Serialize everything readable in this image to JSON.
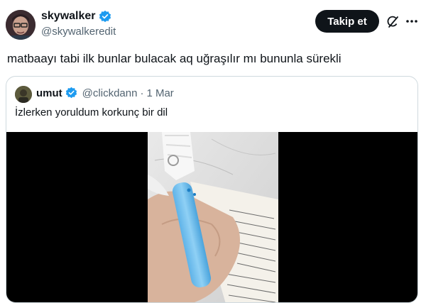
{
  "tweet": {
    "author": {
      "display_name": "skywalker",
      "handle": "@skywalkeredit"
    },
    "follow_label": "Takip et",
    "text": "matbaayı tabi ilk bunlar bulacak aq uğraşılır mı bununla sürekli"
  },
  "quoted_tweet": {
    "author": {
      "display_name": "umut",
      "handle": "@clickdann"
    },
    "separator": "·",
    "date": "1 Mar",
    "text": "İzlerken yoruldum korkunç bir dil"
  },
  "icons": {
    "verified": "verified-badge-icon",
    "grok": "grok-icon",
    "more": "more-options-icon"
  },
  "colors": {
    "verified_blue": "#1d9bf0",
    "secondary_text": "#536471",
    "border": "#cfd9de",
    "follow_button": "#0f1419"
  }
}
